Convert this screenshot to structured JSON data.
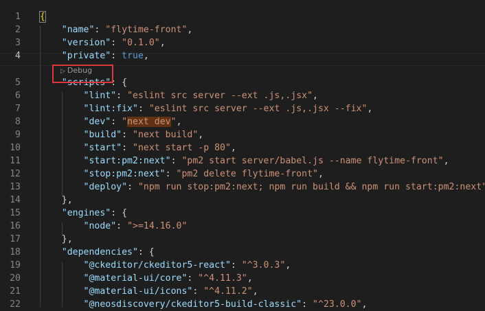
{
  "editor": {
    "codelens_label": "Debug",
    "lines": [
      {
        "num": "1",
        "tokens": [
          {
            "t": "{",
            "c": "bracket"
          }
        ]
      },
      {
        "num": "2",
        "tokens": [
          {
            "t": "    "
          },
          {
            "t": "\"name\"",
            "c": "key"
          },
          {
            "t": ": "
          },
          {
            "t": "\"flytime-front\"",
            "c": "str"
          },
          {
            "t": ","
          }
        ]
      },
      {
        "num": "3",
        "tokens": [
          {
            "t": "    "
          },
          {
            "t": "\"version\"",
            "c": "key"
          },
          {
            "t": ": "
          },
          {
            "t": "\"0.1.0\"",
            "c": "str"
          },
          {
            "t": ","
          }
        ]
      },
      {
        "num": "4",
        "active": true,
        "tokens": [
          {
            "t": "    "
          },
          {
            "t": "\"private\"",
            "c": "key"
          },
          {
            "t": ": "
          },
          {
            "t": "true",
            "c": "bool"
          },
          {
            "t": ","
          }
        ]
      },
      {
        "num": "5",
        "tokens": [
          {
            "t": "    "
          },
          {
            "t": "\"scripts\"",
            "c": "key"
          },
          {
            "t": ": {"
          }
        ]
      },
      {
        "num": "6",
        "tokens": [
          {
            "t": "        "
          },
          {
            "t": "\"lint\"",
            "c": "key"
          },
          {
            "t": ": "
          },
          {
            "t": "\"eslint src server --ext .js,.jsx\"",
            "c": "str"
          },
          {
            "t": ","
          }
        ]
      },
      {
        "num": "7",
        "tokens": [
          {
            "t": "        "
          },
          {
            "t": "\"lint:fix\"",
            "c": "key"
          },
          {
            "t": ": "
          },
          {
            "t": "\"eslint src server --ext .js,.jsx --fix\"",
            "c": "str"
          },
          {
            "t": ","
          }
        ]
      },
      {
        "num": "8",
        "tokens": [
          {
            "t": "        "
          },
          {
            "t": "\"dev\"",
            "c": "key"
          },
          {
            "t": ": "
          },
          {
            "t": "\"",
            "c": "str"
          },
          {
            "t": "next dev",
            "c": "str hl"
          },
          {
            "t": "\"",
            "c": "str"
          },
          {
            "t": ","
          }
        ]
      },
      {
        "num": "9",
        "tokens": [
          {
            "t": "        "
          },
          {
            "t": "\"build\"",
            "c": "key"
          },
          {
            "t": ": "
          },
          {
            "t": "\"next build\"",
            "c": "str"
          },
          {
            "t": ","
          }
        ]
      },
      {
        "num": "10",
        "tokens": [
          {
            "t": "        "
          },
          {
            "t": "\"start\"",
            "c": "key"
          },
          {
            "t": ": "
          },
          {
            "t": "\"next start -p 80\"",
            "c": "str"
          },
          {
            "t": ","
          }
        ]
      },
      {
        "num": "11",
        "tokens": [
          {
            "t": "        "
          },
          {
            "t": "\"start:pm2:next\"",
            "c": "key"
          },
          {
            "t": ": "
          },
          {
            "t": "\"pm2 start server/babel.js --name flytime-front\"",
            "c": "str"
          },
          {
            "t": ","
          }
        ]
      },
      {
        "num": "12",
        "tokens": [
          {
            "t": "        "
          },
          {
            "t": "\"stop:pm2:next\"",
            "c": "key"
          },
          {
            "t": ": "
          },
          {
            "t": "\"pm2 delete flytime-front\"",
            "c": "str"
          },
          {
            "t": ","
          }
        ]
      },
      {
        "num": "13",
        "tokens": [
          {
            "t": "        "
          },
          {
            "t": "\"deploy\"",
            "c": "key"
          },
          {
            "t": ": "
          },
          {
            "t": "\"npm run stop:pm2:next; npm run build && npm run start:pm2:next\"",
            "c": "str"
          }
        ]
      },
      {
        "num": "14",
        "tokens": [
          {
            "t": "    },"
          }
        ]
      },
      {
        "num": "15",
        "tokens": [
          {
            "t": "    "
          },
          {
            "t": "\"engines\"",
            "c": "key"
          },
          {
            "t": ": {"
          }
        ]
      },
      {
        "num": "16",
        "tokens": [
          {
            "t": "        "
          },
          {
            "t": "\"node\"",
            "c": "key"
          },
          {
            "t": ": "
          },
          {
            "t": "\">=14.16.0\"",
            "c": "str"
          }
        ]
      },
      {
        "num": "17",
        "tokens": [
          {
            "t": "    },"
          }
        ]
      },
      {
        "num": "18",
        "tokens": [
          {
            "t": "    "
          },
          {
            "t": "\"dependencies\"",
            "c": "key"
          },
          {
            "t": ": {"
          }
        ]
      },
      {
        "num": "19",
        "tokens": [
          {
            "t": "        "
          },
          {
            "t": "\"@ckeditor/ckeditor5-react\"",
            "c": "key"
          },
          {
            "t": ": "
          },
          {
            "t": "\"^3.0.3\"",
            "c": "str"
          },
          {
            "t": ","
          }
        ]
      },
      {
        "num": "20",
        "tokens": [
          {
            "t": "        "
          },
          {
            "t": "\"@material-ui/core\"",
            "c": "key"
          },
          {
            "t": ": "
          },
          {
            "t": "\"^4.11.3\"",
            "c": "str"
          },
          {
            "t": ","
          }
        ]
      },
      {
        "num": "21",
        "tokens": [
          {
            "t": "        "
          },
          {
            "t": "\"@material-ui/icons\"",
            "c": "key"
          },
          {
            "t": ": "
          },
          {
            "t": "\"^4.11.2\"",
            "c": "str"
          },
          {
            "t": ","
          }
        ]
      },
      {
        "num": "22",
        "tokens": [
          {
            "t": "        "
          },
          {
            "t": "\"@neosdiscovery/ckeditor5-build-classic\"",
            "c": "key"
          },
          {
            "t": ": "
          },
          {
            "t": "\"^23.0.0\"",
            "c": "str"
          },
          {
            "t": ","
          }
        ]
      }
    ]
  }
}
